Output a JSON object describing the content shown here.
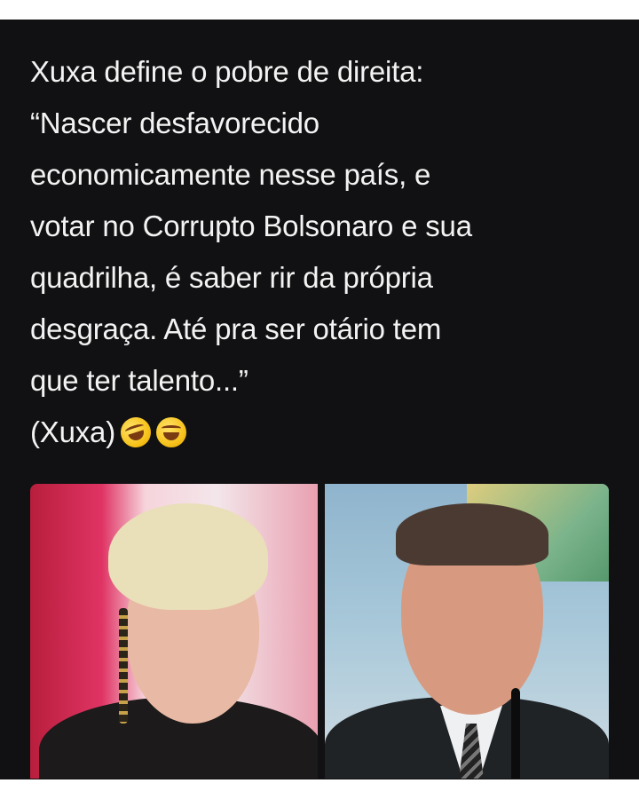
{
  "post": {
    "lines": [
      "Xuxa define o pobre de direita:",
      "“Nascer desfavorecido",
      "economicamente nesse país, e",
      "votar no Corrupto Bolsonaro e sua",
      "quadrilha, é saber rir da própria",
      "desgraça. Até pra ser otário tem",
      "que ter talento...”",
      "(Xuxa)"
    ],
    "emojis": [
      "rolling-on-floor-laughing-icon",
      "tears-of-joy-icon"
    ]
  },
  "colors": {
    "card_background": "#111113",
    "text": "#f3f3f3"
  }
}
